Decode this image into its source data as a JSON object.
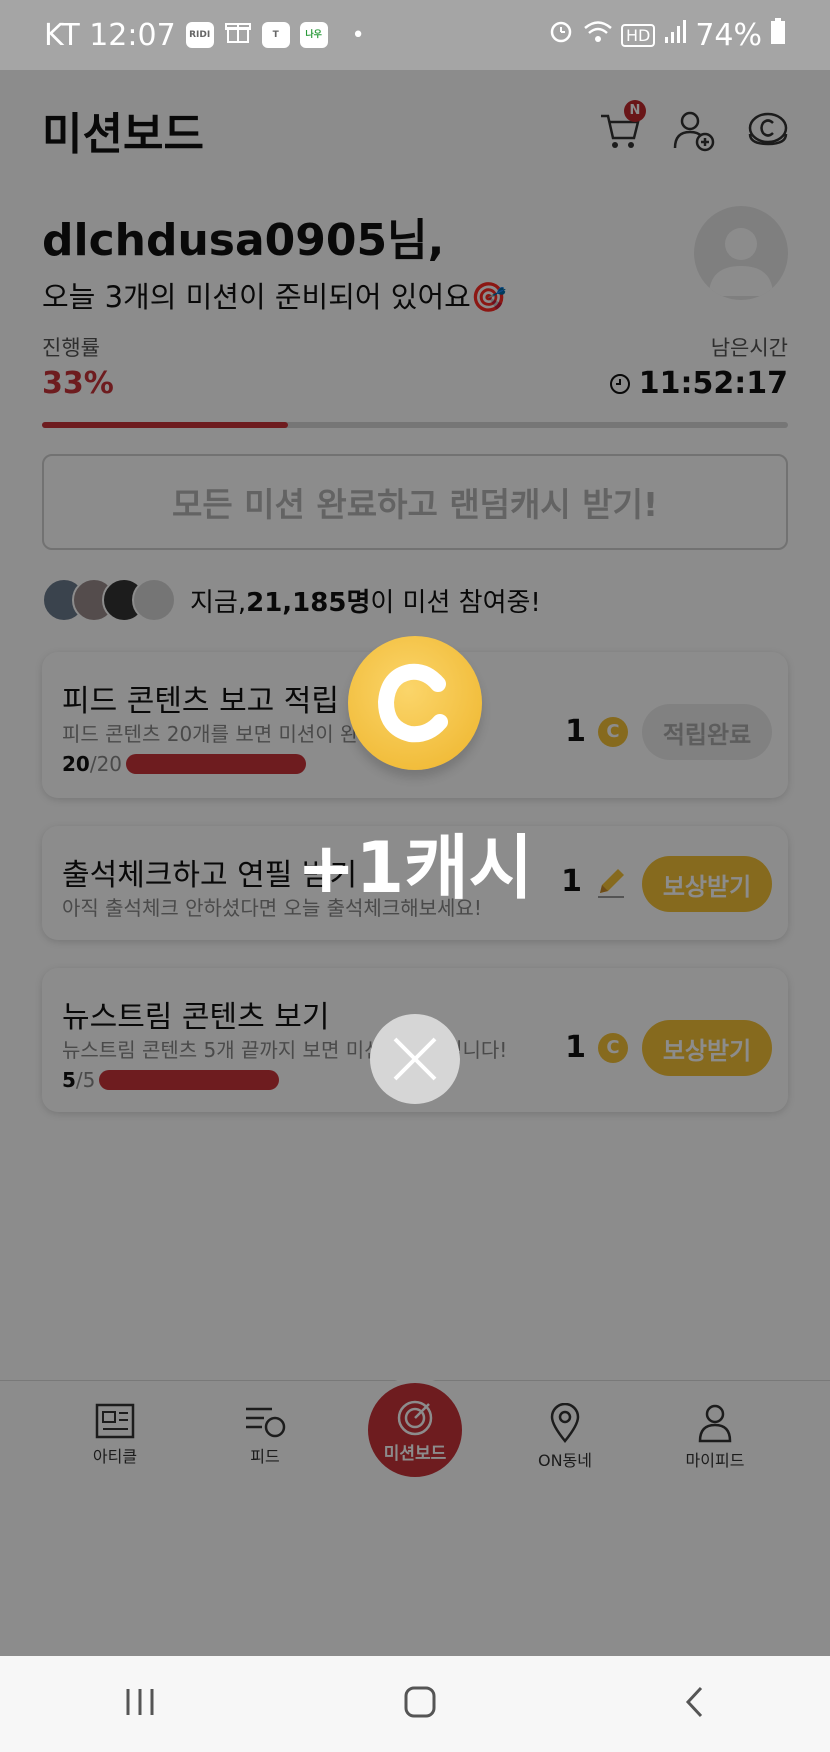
{
  "status_bar": {
    "carrier_time": "KT 12:07",
    "app_icons": [
      "RIDI",
      "gift",
      "T",
      "나우"
    ],
    "dot": "•",
    "hd": "HD",
    "battery": "74%"
  },
  "header": {
    "title": "미션보드",
    "cart_badge": "N"
  },
  "greeting": {
    "name": "dlchdusa0905님,",
    "subtitle": "오늘 3개의 미션이 준비되어 있어요🎯"
  },
  "progress": {
    "label": "진행률",
    "value": "33%",
    "fraction": 0.33,
    "remaining_label": "남은시간",
    "remaining_time": "11:52:17"
  },
  "all_complete_button": "모든 미션 완료하고 랜덤캐시 받기!",
  "participants": {
    "prefix": "지금, ",
    "count": "21,185명",
    "suffix": "이 미션 참여중!"
  },
  "missions": [
    {
      "title": "피드 콘텐츠 보고 적립",
      "desc": "피드 콘텐츠 20개를 보면 미션이 완",
      "progress_done": "20",
      "progress_total": "/20",
      "reward": "1",
      "reward_icon": "coin-icon",
      "button": "적립완료"
    },
    {
      "title": "출석체크하고 연필 받기",
      "desc": "아직 출석체크 안하셨다면 오늘 출석체크해보세요!",
      "reward": "1",
      "reward_icon": "pencil-icon",
      "button": "보상받기"
    },
    {
      "title": "뉴스트림 콘텐츠 보기",
      "desc": "뉴스트림 콘텐츠 5개 끝까지 보면 미션이 완료됩니다!",
      "progress_done": "5",
      "progress_total": "/5",
      "reward": "1",
      "reward_icon": "coin-icon",
      "button": "보상받기"
    }
  ],
  "reward_popup": {
    "text": "+1캐시"
  },
  "tabs": [
    "아티클",
    "피드",
    "미션보드",
    "ON동네",
    "마이피드"
  ],
  "colors": {
    "accent": "#c8333a",
    "coin": "#f5c238"
  }
}
